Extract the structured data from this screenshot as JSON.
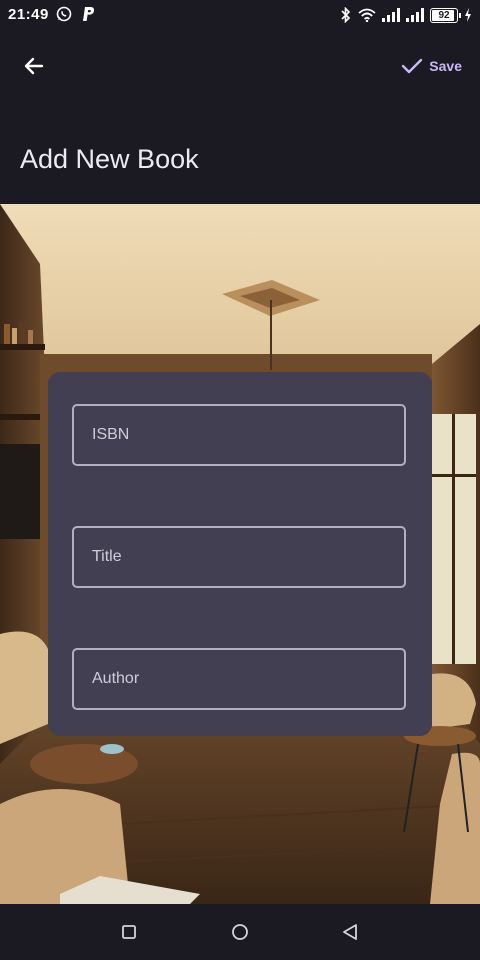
{
  "status_bar": {
    "time": "21:49",
    "battery": "92",
    "icons": [
      "whatsapp-icon",
      "paypal-icon",
      "bluetooth-icon",
      "wifi-icon",
      "signal-icon",
      "signal-icon",
      "battery-icon",
      "charging-icon"
    ]
  },
  "toolbar": {
    "back_icon": "arrow-left-icon",
    "save_icon": "check-icon",
    "save_label": "Save"
  },
  "page": {
    "title": "Add New Book"
  },
  "form": {
    "isbn": {
      "placeholder": "ISBN",
      "value": ""
    },
    "title": {
      "placeholder": "Title",
      "value": ""
    },
    "author": {
      "placeholder": "Author",
      "value": ""
    }
  },
  "nav_bar": {
    "icons": [
      "recent-apps-icon",
      "home-icon",
      "back-icon"
    ]
  },
  "colors": {
    "accent": "#c8b8f5",
    "card": "#433f52",
    "background": "#1b1a22"
  }
}
